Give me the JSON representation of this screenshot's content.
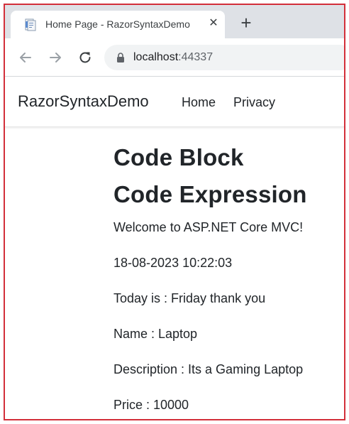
{
  "browser": {
    "tab": {
      "title": "Home Page - RazorSyntaxDemo",
      "favicon": "document-icon",
      "close_icon": "close-icon"
    },
    "new_tab_icon": "plus-icon",
    "toolbar": {
      "back_icon": "back-arrow-icon",
      "forward_icon": "forward-arrow-icon",
      "reload_icon": "reload-icon",
      "lock_icon": "lock-icon",
      "url_host": "localhost",
      "url_port": ":44337"
    }
  },
  "site": {
    "brand": "RazorSyntaxDemo",
    "nav": {
      "home": "Home",
      "privacy": "Privacy"
    }
  },
  "content": {
    "heading1": "Code Block",
    "heading2": "Code Expression",
    "lines": [
      "Welcome to ASP.NET Core MVC!",
      "18-08-2023 10:22:03",
      "Today is : Friday thank you",
      "Name : Laptop",
      "Description : Its a Gaming Laptop",
      "Price : 10000"
    ]
  },
  "colors": {
    "border": "#d32f3a",
    "tab_strip": "#dee1e6",
    "omnibox": "#f1f3f4",
    "text": "#212529"
  }
}
